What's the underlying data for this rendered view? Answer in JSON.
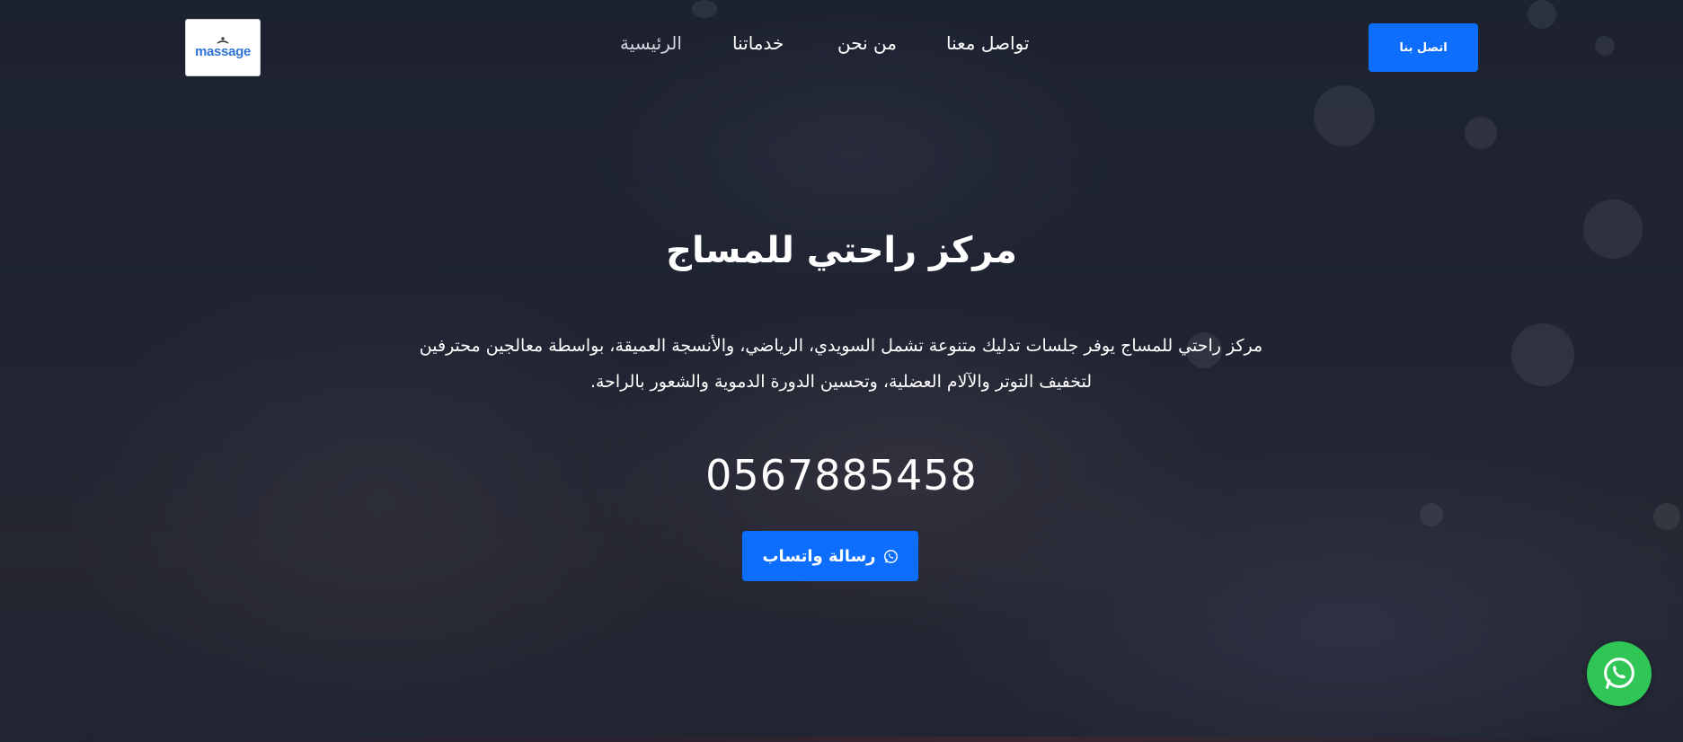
{
  "logo": {
    "text": "massage"
  },
  "nav": {
    "items": [
      {
        "label": "تواصل معنا"
      },
      {
        "label": "من نحن"
      },
      {
        "label": "خدماتنا"
      },
      {
        "label": "الرئيسية"
      }
    ],
    "cta_label": "اتصل بنا"
  },
  "hero": {
    "title": "مركز راحتي للمساج",
    "description": "مركز راحتي للمساج يوفر جلسات تدليك متنوعة تشمل السويدي، الرياضي، والأنسجة العميقة، بواسطة معالجين محترفين لتخفيف التوتر والآلام العضلية، وتحسين الدورة الدموية والشعور بالراحة.",
    "phone": "0567885458",
    "whatsapp_button_label": "رسالة واتساب"
  },
  "colors": {
    "primary": "#0d6efd",
    "whatsapp": "#2fc656",
    "overlay": "#1d2230"
  },
  "icons": {
    "whatsapp_button": "whatsapp-icon",
    "floating": "whatsapp-icon"
  }
}
